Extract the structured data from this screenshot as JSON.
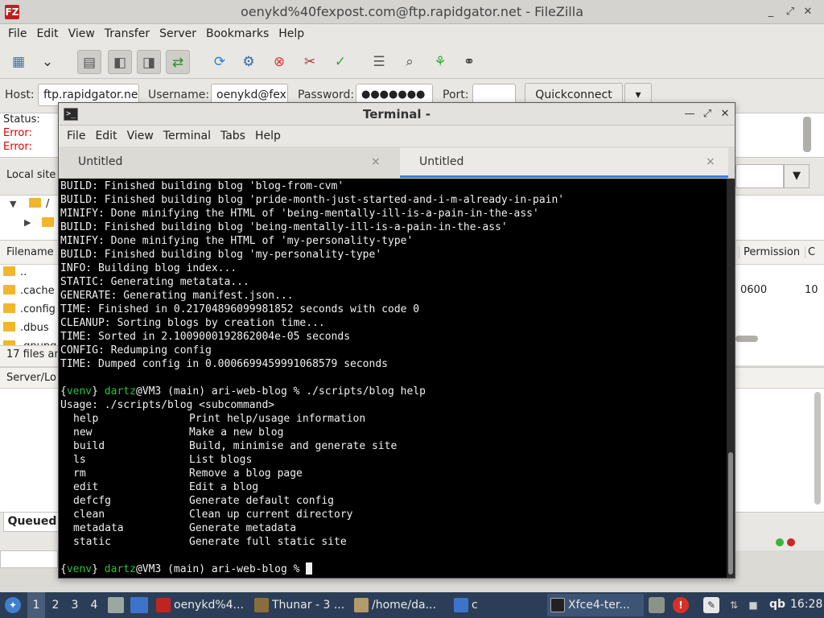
{
  "filezilla": {
    "title": "oenykd%40fexpost.com@ftp.rapidgator.net - FileZilla",
    "logo": "FZ",
    "menu": [
      "File",
      "Edit",
      "View",
      "Transfer",
      "Server",
      "Bookmarks",
      "Help"
    ],
    "quickconnect": {
      "host_label": "Host:",
      "host_value": "ftp.rapidgator.ne",
      "username_label": "Username:",
      "username_value": "oenykd@fex",
      "password_label": "Password:",
      "password_value": "●●●●●●●",
      "port_label": "Port:",
      "port_value": "",
      "button": "Quickconnect",
      "dropdown": "▾"
    },
    "status_lines": [
      {
        "label": "Status:",
        "type": "status"
      },
      {
        "label": "Error:",
        "type": "error"
      },
      {
        "label": "Error:",
        "type": "error"
      }
    ],
    "local_site_label": "Local site",
    "tree_root": "/",
    "columns": {
      "filename": "Filename",
      "permissions": "Permission",
      "extra": "C"
    },
    "files": [
      "..",
      ".cache",
      ".config",
      ".dbus",
      ".gnupg"
    ],
    "permission_value": "0600",
    "size_hint": "10",
    "file_count": "17 files an",
    "server_local_label": "Server/Lo",
    "queued_tab": "Queued"
  },
  "terminal": {
    "title": "Terminal -",
    "icon": ">_",
    "menu": [
      "File",
      "Edit",
      "View",
      "Terminal",
      "Tabs",
      "Help"
    ],
    "tabs": [
      {
        "label": "Untitled",
        "active": false
      },
      {
        "label": "Untitled",
        "active": true
      }
    ],
    "output_lines": [
      "BUILD: Finished building blog 'blog-from-cvm'",
      "BUILD: Finished building blog 'pride-month-just-started-and-i-m-already-in-pain'",
      "MINIFY: Done minifying the HTML of 'being-mentally-ill-is-a-pain-in-the-ass'",
      "BUILD: Finished building blog 'being-mentally-ill-is-a-pain-in-the-ass'",
      "MINIFY: Done minifying the HTML of 'my-personality-type'",
      "BUILD: Finished building blog 'my-personality-type'",
      "INFO: Building blog index...",
      "STATIC: Generating metatata...",
      "GENERATE: Generating manifest.json...",
      "TIME: Finished in 0.21704896099981852 seconds with code 0",
      "CLEANUP: Sorting blogs by creation time...",
      "TIME: Sorted in 2.1009000192862004e-05 seconds",
      "CONFIG: Redumping config",
      "TIME: Dumped config in 0.0006699459991068579 seconds",
      ""
    ],
    "prompt": {
      "venv": "venv",
      "user": "dartz",
      "host": "@VM3 (main) ari-web-blog %"
    },
    "command": "./scripts/blog help",
    "usage": "Usage: ./scripts/blog <subcommand>",
    "subcommands": [
      {
        "name": "help",
        "desc": "Print help/usage information"
      },
      {
        "name": "new",
        "desc": "Make a new blog"
      },
      {
        "name": "build",
        "desc": "Build, minimise and generate site"
      },
      {
        "name": "ls",
        "desc": "List blogs"
      },
      {
        "name": "rm",
        "desc": "Remove a blog page"
      },
      {
        "name": "edit",
        "desc": "Edit a blog"
      },
      {
        "name": "defcfg",
        "desc": "Generate default config"
      },
      {
        "name": "clean",
        "desc": "Clean up current directory"
      },
      {
        "name": "metadata",
        "desc": "Generate metadata"
      },
      {
        "name": "static",
        "desc": "Generate full static site"
      }
    ]
  },
  "taskbar": {
    "workspaces": [
      "1",
      "2",
      "3",
      "4"
    ],
    "tasks": [
      {
        "label": "oenykd%4...",
        "icon_color": "#c0241f"
      },
      {
        "label": "Thunar - 3 ...",
        "icon_color": "#8a6d3b"
      },
      {
        "label": "/home/da...",
        "icon_color": "#b39a6a"
      },
      {
        "label": "c",
        "icon_color": "#3b74c9"
      },
      {
        "label": "Xfce4-ter...",
        "icon_color": "#222222"
      }
    ],
    "keyboard": "qb",
    "clock": "16:28"
  },
  "colors": {
    "accent": "#3584e4",
    "prompt_green": "#29c03a",
    "error_red": "#dd0000"
  }
}
